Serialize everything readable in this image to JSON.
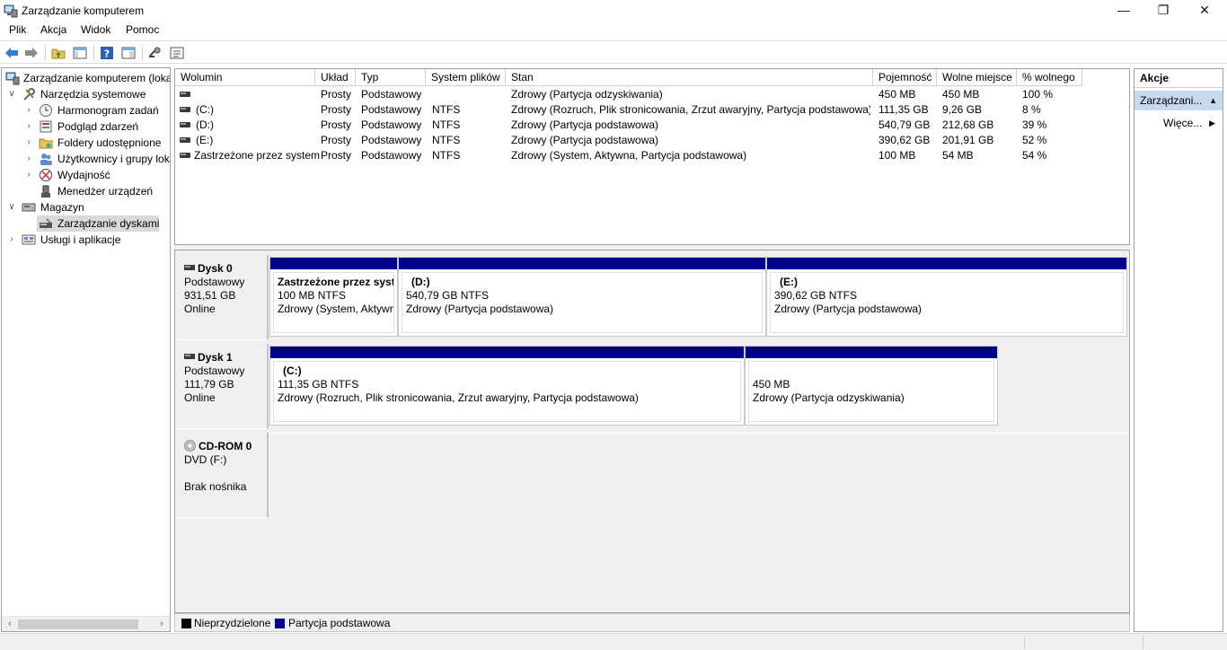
{
  "window": {
    "title": "Zarządzanie komputerem",
    "minimize": "—",
    "restore": "❐",
    "close": "✕"
  },
  "menu": [
    "Plik",
    "Akcja",
    "Widok",
    "Pomoc"
  ],
  "tree": {
    "root": "Zarządzanie komputerem (loka",
    "system_tools": "Narzędzia systemowe",
    "task_scheduler": "Harmonogram zadań",
    "event_viewer": "Podgląd zdarzeń",
    "shared_folders": "Foldery udostępnione",
    "users_groups": "Użytkownicy i grupy lok",
    "performance": "Wydajność",
    "device_manager": "Menedżer urządzeń",
    "storage": "Magazyn",
    "disk_management": "Zarządzanie dyskami",
    "services_apps": "Usługi i aplikacje"
  },
  "volume_list": {
    "headers": [
      "Wolumin",
      "Układ",
      "Typ",
      "System plików",
      "Stan",
      "Pojemność",
      "Wolne miejsce",
      "% wolnego"
    ],
    "rows": [
      {
        "volume": "",
        "layout": "Prosty",
        "type": "Podstawowy",
        "fs": "",
        "status": "Zdrowy (Partycja odzyskiwania)",
        "capacity": "450 MB",
        "free": "450 MB",
        "pct": "100 %"
      },
      {
        "volume": "(C:)",
        "layout": "Prosty",
        "type": "Podstawowy",
        "fs": "NTFS",
        "status": "Zdrowy (Rozruch, Plik stronicowania, Zrzut awaryjny, Partycja podstawowa)",
        "capacity": "111,35 GB",
        "free": "9,26 GB",
        "pct": "8 %"
      },
      {
        "volume": "(D:)",
        "layout": "Prosty",
        "type": "Podstawowy",
        "fs": "NTFS",
        "status": "Zdrowy (Partycja podstawowa)",
        "capacity": "540,79 GB",
        "free": "212,68 GB",
        "pct": "39 %"
      },
      {
        "volume": "(E:)",
        "layout": "Prosty",
        "type": "Podstawowy",
        "fs": "NTFS",
        "status": "Zdrowy (Partycja podstawowa)",
        "capacity": "390,62 GB",
        "free": "201,91 GB",
        "pct": "52 %"
      },
      {
        "volume": "Zastrzeżone przez system",
        "layout": "Prosty",
        "type": "Podstawowy",
        "fs": "NTFS",
        "status": "Zdrowy (System, Aktywna, Partycja podstawowa)",
        "capacity": "100 MB",
        "free": "54 MB",
        "pct": "54 %"
      }
    ]
  },
  "disks": {
    "disk0": {
      "name": "Dysk 0",
      "kind": "Podstawowy",
      "size": "931,51 GB",
      "state": "Online",
      "partitions": [
        {
          "name": "Zastrzeżone przez syst",
          "size": "100 MB NTFS",
          "status": "Zdrowy (System, Aktywr"
        },
        {
          "name": "(D:)",
          "size": "540,79 GB NTFS",
          "status": "Zdrowy (Partycja podstawowa)"
        },
        {
          "name": "(E:)",
          "size": "390,62 GB NTFS",
          "status": "Zdrowy (Partycja podstawowa)"
        }
      ]
    },
    "disk1": {
      "name": "Dysk 1",
      "kind": "Podstawowy",
      "size": "111,79 GB",
      "state": "Online",
      "partitions": [
        {
          "name": "(C:)",
          "size": "111,35 GB NTFS",
          "status": "Zdrowy (Rozruch, Plik stronicowania, Zrzut awaryjny, Partycja podstawowa)"
        },
        {
          "name": "",
          "size": "450 MB",
          "status": "Zdrowy (Partycja odzyskiwania)"
        }
      ]
    },
    "cdrom0": {
      "name": "CD-ROM 0",
      "kind": "DVD (F:)",
      "media": "Brak nośnika"
    }
  },
  "legend": {
    "unallocated": "Nieprzydzielone",
    "primary": "Partycja podstawowa",
    "unallocated_color": "#000000",
    "primary_color": "#00008b"
  },
  "actions": {
    "header": "Akcje",
    "section": "Zarządzani...",
    "more": "Więce..."
  }
}
